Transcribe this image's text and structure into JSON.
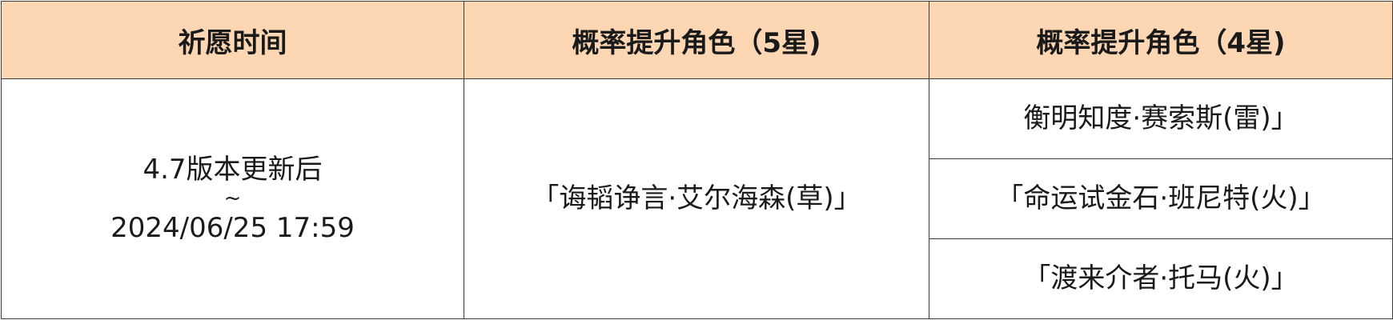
{
  "table": {
    "headers": [
      "祈愿时间",
      "概率提升角色（5星)",
      "概率提升角色（4星)"
    ],
    "time": {
      "start": "4.7版本更新后",
      "separator": "~",
      "end": "2024/06/25 17:59"
    },
    "five_star": "「诲韬诤言·艾尔海森(草)」",
    "four_star": [
      "衡明知度·赛索斯(雷)」",
      "「命运试金石·班尼特(火)」",
      "「渡来介者·托马(火)」"
    ]
  }
}
